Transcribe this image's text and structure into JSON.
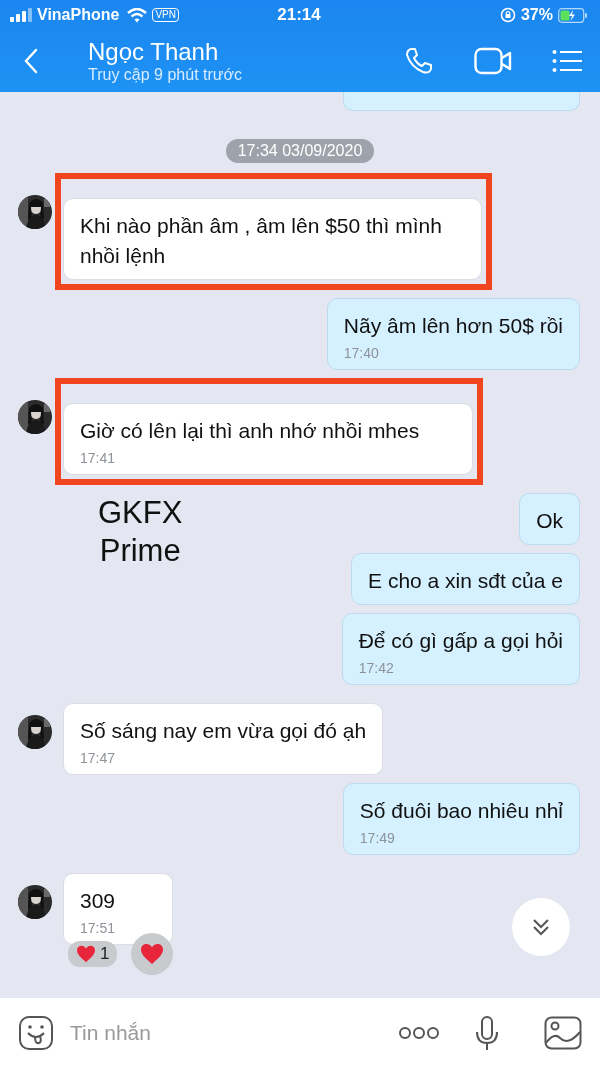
{
  "status_bar": {
    "carrier": "VinaPhone",
    "vpn": "VPN",
    "time": "21:14",
    "battery": "37%"
  },
  "header": {
    "name": "Ngọc Thanh",
    "subtitle": "Truy cập 9 phút trước"
  },
  "chat": {
    "date_separator": "17:34 03/09/2020",
    "messages": [
      {
        "kind": "incoming",
        "text": "Khi nào phần âm , âm lên $50 thì mình nhồi lệnh",
        "highlighted": true
      },
      {
        "kind": "outgoing",
        "text": "Nãy âm lên hơn 50$ rồi",
        "time": "17:40",
        "highlighted": false
      },
      {
        "kind": "incoming",
        "text": "Giờ có lên lại thì anh nhớ nhồi mhes",
        "time": "17:41",
        "highlighted": true
      },
      {
        "kind": "outgoing",
        "text": "Ok",
        "highlighted": false
      },
      {
        "kind": "outgoing",
        "text": "E cho a xin sđt của e",
        "highlighted": false
      },
      {
        "kind": "outgoing",
        "text": "Để có gì gấp a gọi hỏi",
        "time": "17:42",
        "highlighted": false
      },
      {
        "kind": "incoming",
        "text": "Số sáng nay em vừa gọi đó ạh",
        "time": "17:47",
        "highlighted": false
      },
      {
        "kind": "outgoing",
        "text": "Số đuôi bao nhiêu nhỉ",
        "time": "17:49",
        "highlighted": false
      },
      {
        "kind": "incoming",
        "text": "309",
        "time": "17:51",
        "highlighted": false,
        "reactions": [
          {
            "kind": "count",
            "count": "1"
          },
          {
            "kind": "add"
          }
        ]
      }
    ]
  },
  "overlay_text": [
    "GKFX",
    "Prime"
  ],
  "input": {
    "placeholder": "Tin nhắn"
  }
}
